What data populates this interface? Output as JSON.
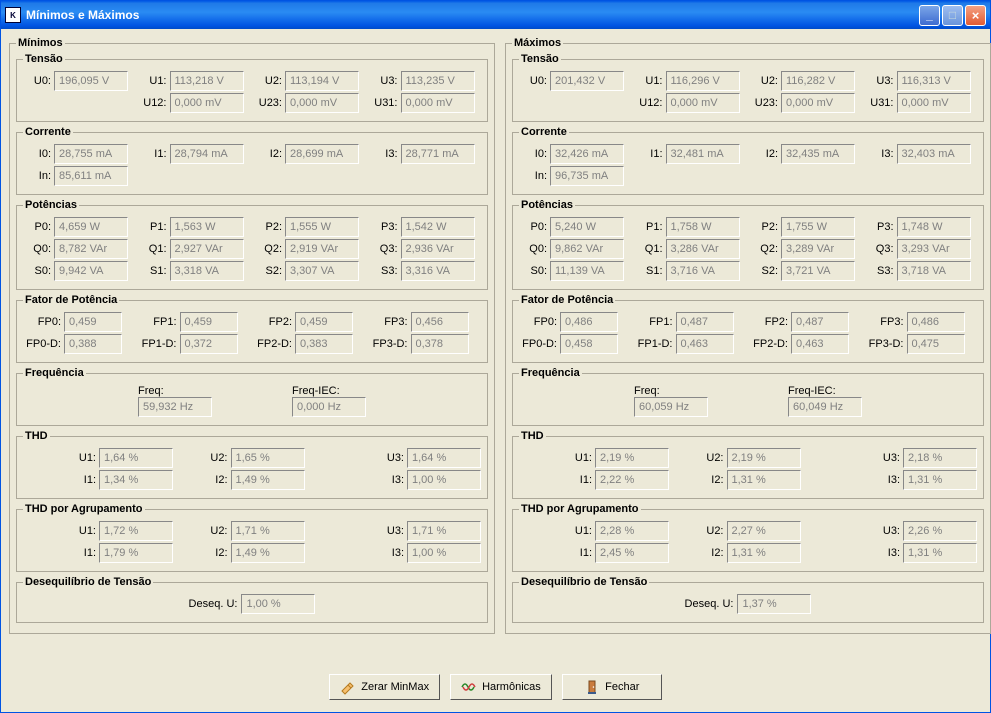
{
  "window": {
    "title": "Mínimos e Máximos"
  },
  "minimos": {
    "title": "Mínimos",
    "tensao": {
      "title": "Tensão",
      "U0": "196,095 V",
      "U1": "113,218 V",
      "U2": "113,194 V",
      "U3": "113,235 V",
      "U12": "0,000 mV",
      "U23": "0,000 mV",
      "U31": "0,000 mV"
    },
    "corrente": {
      "title": "Corrente",
      "I0": "28,755 mA",
      "I1": "28,794 mA",
      "I2": "28,699 mA",
      "I3": "28,771 mA",
      "In": "85,611 mA"
    },
    "potencias": {
      "title": "Potências",
      "P0": "4,659 W",
      "P1": "1,563 W",
      "P2": "1,555 W",
      "P3": "1,542 W",
      "Q0": "8,782 VAr",
      "Q1": "2,927 VAr",
      "Q2": "2,919 VAr",
      "Q3": "2,936 VAr",
      "S0": "9,942 VA",
      "S1": "3,318 VA",
      "S2": "3,307 VA",
      "S3": "3,316 VA"
    },
    "fp": {
      "title": "Fator de Potência",
      "FP0": "0,459",
      "FP1": "0,459",
      "FP2": "0,459",
      "FP3": "0,456",
      "FP0D": "0,388",
      "FP1D": "0,372",
      "FP2D": "0,383",
      "FP3D": "0,378"
    },
    "freq": {
      "title": "Frequência",
      "Freq": "59,932 Hz",
      "FreqIEC": "0,000 Hz"
    },
    "thd": {
      "title": "THD",
      "U1": "1,64 %",
      "U2": "1,65 %",
      "U3": "1,64 %",
      "I1": "1,34 %",
      "I2": "1,49 %",
      "I3": "1,00 %"
    },
    "thda": {
      "title": "THD por Agrupamento",
      "U1": "1,72 %",
      "U2": "1,71 %",
      "U3": "1,71 %",
      "I1": "1,79 %",
      "I2": "1,49 %",
      "I3": "1,00 %"
    },
    "deseq": {
      "title": "Desequilíbrio de Tensão",
      "U": "1,00 %"
    }
  },
  "maximos": {
    "title": "Máximos",
    "tensao": {
      "title": "Tensão",
      "U0": "201,432 V",
      "U1": "116,296 V",
      "U2": "116,282 V",
      "U3": "116,313 V",
      "U12": "0,000 mV",
      "U23": "0,000 mV",
      "U31": "0,000 mV"
    },
    "corrente": {
      "title": "Corrente",
      "I0": "32,426 mA",
      "I1": "32,481 mA",
      "I2": "32,435 mA",
      "I3": "32,403 mA",
      "In": "96,735 mA"
    },
    "potencias": {
      "title": "Potências",
      "P0": "5,240 W",
      "P1": "1,758 W",
      "P2": "1,755 W",
      "P3": "1,748 W",
      "Q0": "9,862 VAr",
      "Q1": "3,286 VAr",
      "Q2": "3,289 VAr",
      "Q3": "3,293 VAr",
      "S0": "11,139 VA",
      "S1": "3,716 VA",
      "S2": "3,721 VA",
      "S3": "3,718 VA"
    },
    "fp": {
      "title": "Fator de Potência",
      "FP0": "0,486",
      "FP1": "0,487",
      "FP2": "0,487",
      "FP3": "0,486",
      "FP0D": "0,458",
      "FP1D": "0,463",
      "FP2D": "0,463",
      "FP3D": "0,475"
    },
    "freq": {
      "title": "Frequência",
      "Freq": "60,059 Hz",
      "FreqIEC": "60,049 Hz"
    },
    "thd": {
      "title": "THD",
      "U1": "2,19 %",
      "U2": "2,19 %",
      "U3": "2,18 %",
      "I1": "2,22 %",
      "I2": "1,31 %",
      "I3": "1,31 %"
    },
    "thda": {
      "title": "THD por Agrupamento",
      "U1": "2,28 %",
      "U2": "2,27 %",
      "U3": "2,26 %",
      "I1": "2,45 %",
      "I2": "1,31 %",
      "I3": "1,31 %"
    },
    "deseq": {
      "title": "Desequilíbrio de Tensão",
      "U": "1,37 %"
    }
  },
  "labels": {
    "U0": "U0:",
    "U1": "U1:",
    "U2": "U2:",
    "U3": "U3:",
    "U12": "U12:",
    "U23": "U23:",
    "U31": "U31:",
    "I0": "I0:",
    "I1": "I1:",
    "I2": "I2:",
    "I3": "I3:",
    "In": "In:",
    "P0": "P0:",
    "P1": "P1:",
    "P2": "P2:",
    "P3": "P3:",
    "Q0": "Q0:",
    "Q1": "Q1:",
    "Q2": "Q2:",
    "Q3": "Q3:",
    "S0": "S0:",
    "S1": "S1:",
    "S2": "S2:",
    "S3": "S3:",
    "FP0": "FP0:",
    "FP1": "FP1:",
    "FP2": "FP2:",
    "FP3": "FP3:",
    "FP0D": "FP0-D:",
    "FP1D": "FP1-D:",
    "FP2D": "FP2-D:",
    "FP3D": "FP3-D:",
    "Freq": "Freq:",
    "FreqIEC": "Freq-IEC:",
    "tU1": "U1:",
    "tU2": "U2:",
    "tU3": "U3:",
    "tI1": "I1:",
    "tI2": "I2:",
    "tI3": "I3:",
    "DeseqU": "Deseq. U:"
  },
  "buttons": {
    "zerar": "Zerar MinMax",
    "harmonicas": "Harmônicas",
    "fechar": "Fechar"
  }
}
